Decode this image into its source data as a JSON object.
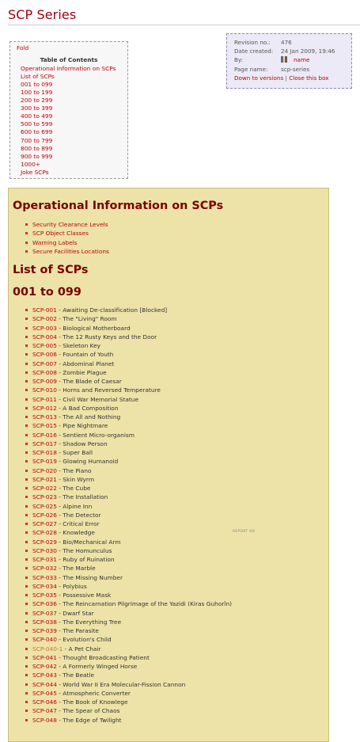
{
  "page": {
    "title": "SCP Series"
  },
  "toc": {
    "fold_label": "Fold",
    "title": "Table of Contents",
    "items": [
      "Operational Information on SCPs",
      "List of SCPs",
      "001 to 099",
      "100 to 199",
      "200 to 299",
      "300 to 399",
      "400 to 499",
      "500 to 599",
      "600 to 699",
      "700 to 799",
      "800 to 899",
      "900 to 999",
      "1000+",
      "Joke SCPs"
    ]
  },
  "page_info": {
    "revision_label": "Revision no.:",
    "revision_value": "476",
    "created_label": "Date created:",
    "created_value": "24 Jan 2009, 19:46",
    "by_label": "By:",
    "by_value": "name",
    "name_label": "Page name:",
    "name_value": "scp-series",
    "down_link": "Down to versions",
    "separator": "|",
    "close_link": "Close this box"
  },
  "content": {
    "op_heading": "Operational Information on SCPs",
    "op_links": [
      "Security Clearance Levels",
      "SCP Object Classes",
      "Warning Labels",
      "Secure Facilities Locations"
    ],
    "list_heading": "List of SCPs",
    "range_heading": "001 to 099",
    "report_ad": "REPORT AD",
    "scps": [
      {
        "num": "SCP-001",
        "title": "Awaiting De-classification [Blocked]"
      },
      {
        "num": "SCP-002",
        "title": "The \"Living\" Room"
      },
      {
        "num": "SCP-003",
        "title": "Biological Motherboard"
      },
      {
        "num": "SCP-004",
        "title": "The 12 Rusty Keys and the Door"
      },
      {
        "num": "SCP-005",
        "title": "Skeleton Key"
      },
      {
        "num": "SCP-006",
        "title": "Fountain of Youth"
      },
      {
        "num": "SCP-007",
        "title": "Abdominal Planet"
      },
      {
        "num": "SCP-008",
        "title": "Zombie Plague"
      },
      {
        "num": "SCP-009",
        "title": "The Blade of Caesar"
      },
      {
        "num": "SCP-010",
        "title": "Horns and Reversed Temperature"
      },
      {
        "num": "SCP-011",
        "title": "Civil War Memorial Statue"
      },
      {
        "num": "SCP-012",
        "title": "A Bad Composition"
      },
      {
        "num": "SCP-013",
        "title": "The All and Nothing"
      },
      {
        "num": "SCP-015",
        "title": "Pipe Nightmare"
      },
      {
        "num": "SCP-016",
        "title": "Sentient Micro-organism"
      },
      {
        "num": "SCP-017",
        "title": "Shadow Person"
      },
      {
        "num": "SCP-018",
        "title": "Super Ball"
      },
      {
        "num": "SCP-019",
        "title": "Glowing Humanoid"
      },
      {
        "num": "SCP-020",
        "title": "The Piano"
      },
      {
        "num": "SCP-021",
        "title": "Skin Wyrm"
      },
      {
        "num": "SCP-022",
        "title": "The Cube"
      },
      {
        "num": "SCP-023",
        "title": "The Installation"
      },
      {
        "num": "SCP-025",
        "title": "Alpine Inn"
      },
      {
        "num": "SCP-026",
        "title": "The Detector"
      },
      {
        "num": "SCP-027",
        "title": "Critical Error"
      },
      {
        "num": "SCP-028",
        "title": "Knowledge"
      },
      {
        "num": "SCP-029",
        "title": "Bio/Mechanical Arm"
      },
      {
        "num": "SCP-030",
        "title": "The Homunculus"
      },
      {
        "num": "SCP-031",
        "title": "Ruby of Ruination"
      },
      {
        "num": "SCP-032",
        "title": "The Marble"
      },
      {
        "num": "SCP-033",
        "title": "The Missing Number"
      },
      {
        "num": "SCP-034",
        "title": "Polybius"
      },
      {
        "num": "SCP-035",
        "title": "Possessive Mask"
      },
      {
        "num": "SCP-036",
        "title": "The Reincarnation Pilgrimage of the Yazidi (Kiras Guhorîn)"
      },
      {
        "num": "SCP-037",
        "title": "Dwarf Star"
      },
      {
        "num": "SCP-038",
        "title": "The Everything Tree"
      },
      {
        "num": "SCP-039",
        "title": "The Parasite"
      },
      {
        "num": "SCP-040",
        "title": "Evolution's Child"
      },
      {
        "num": "SCP-040-1",
        "title": "A Pet Chair",
        "visited": true
      },
      {
        "num": "SCP-041",
        "title": "Thought Broadcasting Patient"
      },
      {
        "num": "SCP-042",
        "title": "A Formerly Winged Horse"
      },
      {
        "num": "SCP-043",
        "title": "The Beatle"
      },
      {
        "num": "SCP-044",
        "title": "World War II Era Molecular-Fission Cannon"
      },
      {
        "num": "SCP-045",
        "title": "Atmospheric Converter"
      },
      {
        "num": "SCP-046",
        "title": "The Book of Knowlege"
      },
      {
        "num": "SCP-047",
        "title": "The Spear of Chaos"
      },
      {
        "num": "SCP-048",
        "title": "The Edge of Twilight"
      }
    ]
  },
  "colors": {
    "link": "#bb0011",
    "visited_link": "#c67a2e",
    "heading": "#7a0000",
    "content_bg": "#ede3a8",
    "info_bg": "#ebeaf6"
  }
}
